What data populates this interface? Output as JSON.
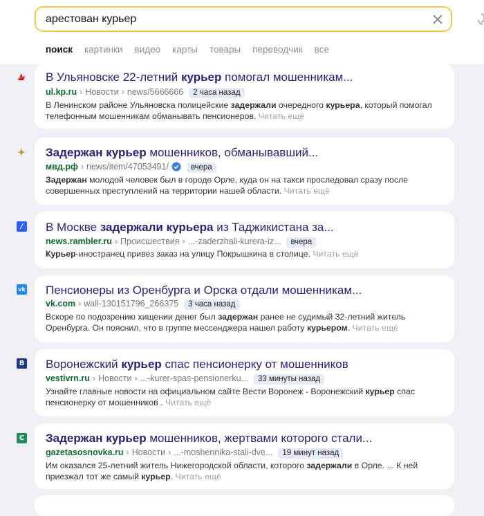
{
  "search": {
    "query": "арестован курьер"
  },
  "tabs": [
    "поиск",
    "картинки",
    "видео",
    "карты",
    "товары",
    "переводчик",
    "все"
  ],
  "results": [
    {
      "title_parts": [
        [
          "В Ульяновске 22-летний ",
          false
        ],
        [
          "курьер",
          true
        ],
        [
          " помогал мошенникам...",
          false
        ]
      ],
      "domain": "ul.kp.ru",
      "crumbs": [
        "Новости",
        "news/5666666"
      ],
      "time": "2 часа назад",
      "snippet_parts": [
        [
          "В Ленинском районе Ульяновска полицейские ",
          false
        ],
        [
          "задержали",
          true
        ],
        [
          " очередного ",
          false
        ],
        [
          "курьера",
          true
        ],
        [
          ", который помогал телефонным мошенникам обманывать пенсионеров.",
          false
        ]
      ],
      "more": "Читать ещё"
    },
    {
      "title_parts": [
        [
          "Задержан курьер",
          true
        ],
        [
          " мошенников, обманывавший...",
          false
        ]
      ],
      "domain": "мвд.рф",
      "crumbs": [
        "news/item/47053491/"
      ],
      "time": "вчера",
      "snippet_parts": [
        [
          "Задержан",
          true
        ],
        [
          " молодой человек был в городе Орле, куда он на такси проследовал сразу после совершенных преступлений на территории нашей области.",
          false
        ]
      ],
      "more": "Читать ещё"
    },
    {
      "title_parts": [
        [
          "В Москве ",
          false
        ],
        [
          "задержали курьера",
          true
        ],
        [
          " из Таджикистана за...",
          false
        ]
      ],
      "domain": "news.rambler.ru",
      "crumbs": [
        "Происшествия",
        "...-zaderzhali-kurera-iz..."
      ],
      "time": "вчера",
      "snippet_parts": [
        [
          "Курьер",
          true
        ],
        [
          "-иностранец привез заказ на улицу Покрышкина в столице.",
          false
        ]
      ],
      "more": "Читать ещё"
    },
    {
      "title_parts": [
        [
          "Пенсионеры из Оренбурга и Орска отдали мошенникам...",
          false
        ]
      ],
      "domain": "vk.com",
      "crumbs": [
        "wall-130151796_266375"
      ],
      "time": "3 часа назад",
      "snippet_parts": [
        [
          "Вскоре по подозрению хищении денег был ",
          false
        ],
        [
          "задержан",
          true
        ],
        [
          " ранее не судимый 32-летний житель Оренбурга. Он пояснил, что в группе мессенджера нашел работу ",
          false
        ],
        [
          "курьером",
          true
        ],
        [
          ".",
          false
        ]
      ],
      "more": "Читать ещё"
    },
    {
      "title_parts": [
        [
          "Воронежский ",
          false
        ],
        [
          "курьер",
          true
        ],
        [
          " спас пенсионерку от мошенников",
          false
        ]
      ],
      "domain": "vestivrn.ru",
      "crumbs": [
        "Новости",
        "...-kurer-spas-pensionerku..."
      ],
      "time": "33 минуты назад",
      "snippet_parts": [
        [
          "Узнайте главные новости на официальном сайте Вести Воронеж - Воронежский ",
          false
        ],
        [
          "курьер",
          true
        ],
        [
          " спас пенсионерку от мошенников .",
          false
        ]
      ],
      "more": "Читать ещё"
    },
    {
      "title_parts": [
        [
          "Задержан курьер",
          true
        ],
        [
          " мошенников, жертвами которого стали...",
          false
        ]
      ],
      "domain": "gazetasosnovka.ru",
      "crumbs": [
        "Новости",
        "...-moshennika-stali-dve..."
      ],
      "time": "19 минут назад",
      "snippet_parts": [
        [
          "Им оказался 25-летний житель Нижегородской области, которого ",
          false
        ],
        [
          "задержали",
          true
        ],
        [
          " в Орле. ... К ней приезжал тот же самый ",
          false
        ],
        [
          "курьер",
          true
        ],
        [
          ".",
          false
        ]
      ],
      "more": "Читать ещё"
    }
  ],
  "favicons": {
    "r0": {
      "icon": "kp-icon",
      "color": "#c8102e"
    },
    "r1": {
      "icon": "mvd-emblem-icon",
      "color": "#b89a3a"
    },
    "r2": {
      "icon": "rambler-icon",
      "color": "#315efb",
      "glyph": "/"
    },
    "r3": {
      "icon": "vk-icon",
      "color": "#2787f5",
      "glyph": "vk"
    },
    "r4": {
      "icon": "vesti-icon",
      "color": "#1b3a8a",
      "glyph": "В"
    },
    "r5": {
      "icon": "sosnovka-icon",
      "color": "#1e8a5e",
      "glyph": "С"
    }
  },
  "colors": {
    "accent": "#f3c84b",
    "title": "#2a1f7a",
    "domain": "#0c6b2d",
    "badge": "#e5ebf6"
  }
}
